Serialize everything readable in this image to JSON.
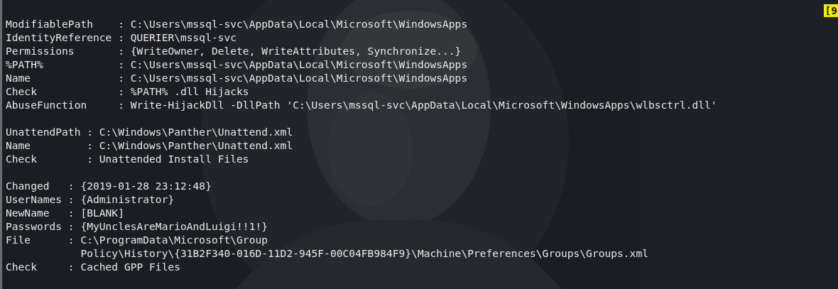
{
  "indicator": {
    "text": "[9"
  },
  "blocks": [
    {
      "lines": [
        "ModifiablePath    : C:\\Users\\mssql-svc\\AppData\\Local\\Microsoft\\WindowsApps",
        "IdentityReference : QUERIER\\mssql-svc",
        "Permissions       : {WriteOwner, Delete, WriteAttributes, Synchronize...}",
        "%PATH%            : C:\\Users\\mssql-svc\\AppData\\Local\\Microsoft\\WindowsApps",
        "Name              : C:\\Users\\mssql-svc\\AppData\\Local\\Microsoft\\WindowsApps",
        "Check             : %PATH% .dll Hijacks",
        "AbuseFunction     : Write-HijackDll -DllPath 'C:\\Users\\mssql-svc\\AppData\\Local\\Microsoft\\WindowsApps\\wlbsctrl.dll'"
      ]
    },
    {
      "lines": [
        "UnattendPath : C:\\Windows\\Panther\\Unattend.xml",
        "Name         : C:\\Windows\\Panther\\Unattend.xml",
        "Check        : Unattended Install Files"
      ]
    },
    {
      "lines": [
        "Changed   : {2019-01-28 23:12:48}",
        "UserNames : {Administrator}",
        "NewName   : [BLANK]",
        "Passwords : {MyUnclesAreMarioAndLuigi!!1!}",
        "File      : C:\\ProgramData\\Microsoft\\Group",
        "            Policy\\History\\{31B2F340-016D-11D2-945F-00C04FB984F9}\\Machine\\Preferences\\Groups\\Groups.xml",
        "Check     : Cached GPP Files"
      ]
    }
  ]
}
